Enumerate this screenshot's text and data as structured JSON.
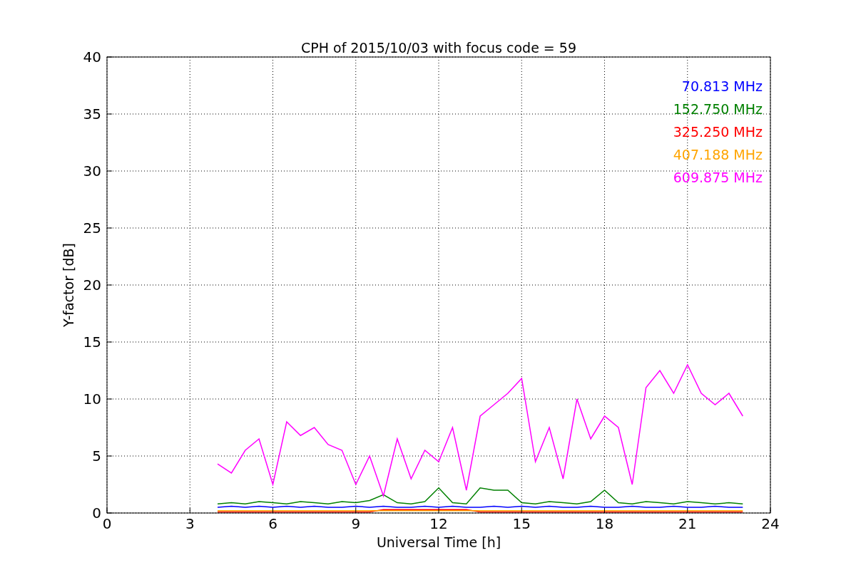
{
  "chart_data": {
    "type": "line",
    "title": "CPH of 2015/10/03 with focus code = 59",
    "xlabel": "Universal Time [h]",
    "ylabel": "Y-factor [dB]",
    "x": [
      4,
      4.5,
      5,
      5.5,
      6,
      6.5,
      7,
      7.5,
      8,
      8.5,
      9,
      9.5,
      10,
      10.5,
      11,
      11.5,
      12,
      12.5,
      13,
      13.5,
      14,
      14.5,
      15,
      15.5,
      16,
      16.5,
      17,
      17.5,
      18,
      18.5,
      19,
      19.5,
      20,
      20.5,
      21,
      21.5,
      22,
      22.5,
      23
    ],
    "series": [
      {
        "name": "70.813 MHz",
        "color": "#0000ff",
        "values": [
          0.5,
          0.6,
          0.5,
          0.6,
          0.5,
          0.6,
          0.5,
          0.6,
          0.5,
          0.5,
          0.6,
          0.5,
          0.6,
          0.5,
          0.5,
          0.6,
          0.5,
          0.6,
          0.5,
          0.5,
          0.6,
          0.5,
          0.6,
          0.5,
          0.6,
          0.5,
          0.5,
          0.6,
          0.5,
          0.5,
          0.6,
          0.5,
          0.5,
          0.6,
          0.5,
          0.5,
          0.6,
          0.5,
          0.5
        ]
      },
      {
        "name": "152.750 MHz",
        "color": "#008000",
        "values": [
          0.8,
          0.9,
          0.8,
          1,
          0.9,
          0.8,
          1,
          0.9,
          0.8,
          1,
          0.9,
          1.1,
          1.6,
          0.9,
          0.8,
          1,
          2.2,
          0.9,
          0.8,
          2.2,
          2,
          2,
          0.9,
          0.8,
          1,
          0.9,
          0.8,
          1,
          2,
          0.9,
          0.8,
          1,
          0.9,
          0.8,
          1,
          0.9,
          0.8,
          0.9,
          0.8
        ]
      },
      {
        "name": "325.250 MHz",
        "color": "#ff0000",
        "values": [
          0.1,
          0.1,
          0.1,
          0.1,
          0.1,
          0.1,
          0.1,
          0.1,
          0.1,
          0.1,
          0.1,
          0.1,
          0.3,
          0.3,
          0.3,
          0.3,
          0.3,
          0.3,
          0.3,
          0.1,
          0.1,
          0.1,
          0.1,
          0.1,
          0.1,
          0.1,
          0.1,
          0.1,
          0.1,
          0.1,
          0.1,
          0.1,
          0.1,
          0.1,
          0.1,
          0.1,
          0.1,
          0.1,
          0.1
        ]
      },
      {
        "name": "407.188 MHz",
        "color": "#ffa500",
        "values": [
          0.2,
          0.2,
          0.2,
          0.2,
          0.2,
          0.2,
          0.2,
          0.2,
          0.2,
          0.2,
          0.2,
          0.2,
          0.2,
          0.2,
          0.2,
          0.2,
          0.2,
          0.2,
          0.2,
          0.2,
          0.2,
          0.2,
          0.2,
          0.2,
          0.2,
          0.2,
          0.2,
          0.2,
          0.2,
          0.2,
          0.2,
          0.2,
          0.2,
          0.2,
          0.2,
          0.2,
          0.2,
          0.2,
          0.2
        ]
      },
      {
        "name": "609.875 MHz",
        "color": "#ff00ff",
        "values": [
          4.3,
          3.5,
          5.5,
          6.5,
          2.5,
          8,
          6.8,
          7.5,
          6,
          5.5,
          2.5,
          5,
          1.5,
          6.5,
          3,
          5.5,
          4.5,
          7.5,
          2,
          8.5,
          9.5,
          10.5,
          11.8,
          4.5,
          7.5,
          3,
          10,
          6.5,
          8.5,
          7.5,
          2.5,
          11,
          12.5,
          10.5,
          13,
          10.5,
          9.5,
          10.5,
          8.5
        ]
      }
    ],
    "xlim": [
      0,
      24
    ],
    "ylim": [
      0,
      40
    ],
    "xticks": [
      0,
      3,
      6,
      9,
      12,
      15,
      18,
      21,
      24
    ],
    "yticks": [
      0,
      5,
      10,
      15,
      20,
      25,
      30,
      35,
      40
    ],
    "grid": true
  }
}
